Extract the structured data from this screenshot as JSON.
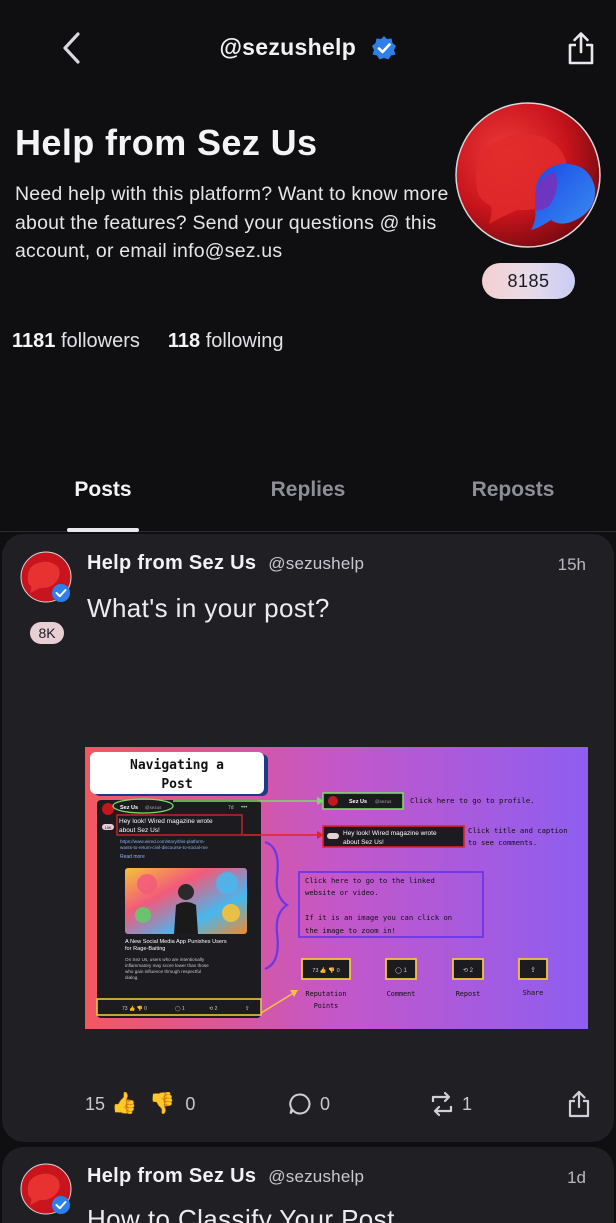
{
  "header": {
    "handle": "@sezushelp",
    "back_icon": "back-chevron-icon",
    "share_icon": "share-icon",
    "verified_icon": "verified-badge-icon"
  },
  "profile": {
    "name": "Help from Sez Us",
    "bio": "Need help with this platform? Want to know more about the features? Send your questions @ this account, or email info@sez.us",
    "reputation": "8185",
    "followers_count": "1181",
    "followers_label": "followers",
    "following_count": "118",
    "following_label": "following"
  },
  "tabs": [
    {
      "label": "Posts",
      "active": true
    },
    {
      "label": "Replies",
      "active": false
    },
    {
      "label": "Reposts",
      "active": false
    }
  ],
  "posts": [
    {
      "author": "Help from Sez Us",
      "handle": "@sezushelp",
      "time": "15h",
      "reputation": "8K",
      "title": "What's in your post?",
      "image": {
        "heading": "Navigating a Post",
        "mini_author": "Sez Us",
        "mini_handle": "@sezus",
        "mini_time": "7d",
        "mini_badge": "15K",
        "mini_title": "Hey look! Wired magazine wrote about Sez Us!",
        "mini_url": "https://www.wired.com/story/this-platform-wants-to-return-civil-discourse-to-social-me",
        "mini_read_more": "Read more",
        "mini_link_title": "A New Social Media App Punishes Users for Rage-Baiting",
        "mini_link_desc": "On Sez Us, users who are intentionally inflammatory may score lower than those who gain influence through respectful dialog.",
        "mini_actions": "73 👍 👎 0   ◯ 1   ⟲ 2   ⇪",
        "callout_profile": "Click here to go to profile.",
        "callout_title": "Click title and caption to see comments.",
        "callout_link_1": "Click here to go to the linked website or video.",
        "callout_link_2": "If it is an image you can click on the image to zoom in!",
        "label_reputation": "Reputation Points",
        "label_comment": "Comment",
        "label_repost": "Repost",
        "label_share": "Share",
        "btn_rep": "73 👍 👎 0",
        "btn_comment": "◯ 1",
        "btn_repost": "⟲ 2",
        "btn_share": "⇪",
        "colors": {
          "gradient_left": "#f2585f",
          "gradient_mid": "#c457c9",
          "gradient_right": "#8e5ef0",
          "green": "#7bdc63",
          "red": "#e0242c",
          "purple": "#6a37e8",
          "yellow": "#f5c340"
        }
      },
      "upvotes": "15",
      "downvotes": "0",
      "comments": "0",
      "reposts": "1"
    },
    {
      "author": "Help from Sez Us",
      "handle": "@sezushelp",
      "time": "1d",
      "title": "How to Classify Your Post"
    }
  ]
}
